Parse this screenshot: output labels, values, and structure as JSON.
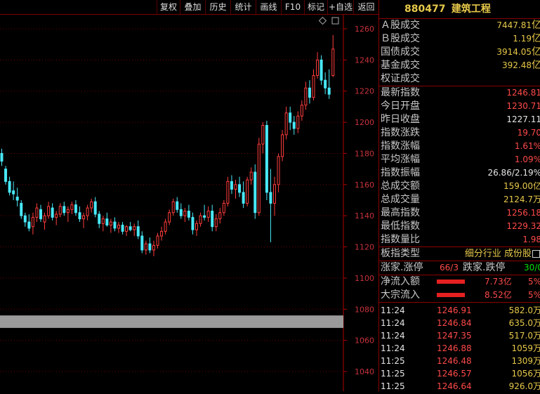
{
  "toolbar": [
    "复权",
    "叠加",
    "历史",
    "统计",
    "画线",
    "F10",
    "标记",
    "+自选",
    "返回"
  ],
  "stock": {
    "code": "880477",
    "name": "建筑工程"
  },
  "volume_rows": [
    {
      "label": "Ａ股成交",
      "value": "7447.81",
      "unit": "亿"
    },
    {
      "label": "Ｂ股成交",
      "value": "1.19",
      "unit": "亿"
    },
    {
      "label": "国债成交",
      "value": "3914.05",
      "unit": "亿"
    },
    {
      "label": "基金成交",
      "value": "392.48",
      "unit": "亿"
    },
    {
      "label": "权证成交",
      "value": "",
      "unit": ""
    }
  ],
  "index_rows": [
    {
      "label": "最新指数",
      "value": "1246.81",
      "color": "r"
    },
    {
      "label": "今日开盘",
      "value": "1230.71",
      "color": "r"
    },
    {
      "label": "昨日收盘",
      "value": "1227.11",
      "color": "w"
    },
    {
      "label": "指数涨跌",
      "value": "19.70",
      "color": "r"
    },
    {
      "label": "指数涨幅",
      "value": "1.61%",
      "color": "r"
    },
    {
      "label": "平均涨幅",
      "value": "1.09%",
      "color": "r"
    },
    {
      "label": "指数振幅",
      "value": "26.86/2.19%",
      "color": "w"
    },
    {
      "label": "总成交额",
      "value": "159.00亿",
      "color": "y"
    },
    {
      "label": "总成交量",
      "value": "2124.7万",
      "color": "y"
    },
    {
      "label": "最高指数",
      "value": "1256.18",
      "color": "r"
    },
    {
      "label": "最低指数",
      "value": "1229.32",
      "color": "r"
    },
    {
      "label": "指数量比",
      "value": "1.98",
      "color": "r"
    }
  ],
  "board": {
    "label": "板指类型",
    "value": "细分行业 成份股"
  },
  "updown": {
    "label1": "涨家.涨停",
    "val1": "66/3",
    "label2": "跌家.跌停",
    "val2": "30/0"
  },
  "flows": [
    {
      "label": "净流入额",
      "value": "7.73亿",
      "pct": "5%"
    },
    {
      "label": "大宗流入",
      "value": "8.52亿",
      "pct": "5%"
    }
  ],
  "ticks": [
    {
      "time": "11:24",
      "price": "1246.91",
      "vol": "582.0万"
    },
    {
      "time": "11:24",
      "price": "1246.84",
      "vol": "635.0万"
    },
    {
      "time": "11:24",
      "price": "1247.35",
      "vol": "517.0万"
    },
    {
      "time": "11:24",
      "price": "1246.88",
      "vol": "1059万"
    },
    {
      "time": "11:25",
      "price": "1246.48",
      "vol": "1309万"
    },
    {
      "time": "11:25",
      "price": "1246.57",
      "vol": "1056万"
    },
    {
      "time": "11:25",
      "price": "1246.64",
      "vol": "926.0万"
    }
  ],
  "chart_data": {
    "type": "candlestick",
    "y_ticks": [
      1260,
      1240,
      1220,
      1200,
      1180,
      1160,
      1140,
      1120,
      1100,
      1080,
      1060,
      1040
    ],
    "ylim": [
      1033,
      1269
    ],
    "candles": [
      [
        1180,
        1183,
        1172,
        1175
      ],
      [
        1170,
        1172,
        1160,
        1162
      ],
      [
        1162,
        1165,
        1153,
        1155
      ],
      [
        1156,
        1162,
        1150,
        1154
      ],
      [
        1152,
        1158,
        1146,
        1150
      ],
      [
        1148,
        1150,
        1138,
        1140
      ],
      [
        1140,
        1142,
        1133,
        1136
      ],
      [
        1136,
        1141,
        1130,
        1132
      ],
      [
        1133,
        1142,
        1128,
        1139
      ],
      [
        1139,
        1148,
        1136,
        1145
      ],
      [
        1144,
        1147,
        1136,
        1138
      ],
      [
        1136,
        1142,
        1131,
        1140
      ],
      [
        1140,
        1149,
        1138,
        1146
      ],
      [
        1145,
        1148,
        1137,
        1139
      ],
      [
        1139,
        1143,
        1134,
        1141
      ],
      [
        1141,
        1148,
        1139,
        1146
      ],
      [
        1146,
        1149,
        1140,
        1142
      ],
      [
        1142,
        1146,
        1136,
        1144
      ],
      [
        1144,
        1149,
        1141,
        1147
      ],
      [
        1147,
        1150,
        1140,
        1142
      ],
      [
        1142,
        1146,
        1136,
        1138
      ],
      [
        1138,
        1142,
        1132,
        1140
      ],
      [
        1140,
        1147,
        1137,
        1145
      ],
      [
        1145,
        1151,
        1142,
        1149
      ],
      [
        1149,
        1152,
        1139,
        1141
      ],
      [
        1141,
        1143,
        1132,
        1135
      ],
      [
        1135,
        1140,
        1130,
        1138
      ],
      [
        1138,
        1142,
        1133,
        1134
      ],
      [
        1134,
        1138,
        1129,
        1136
      ],
      [
        1136,
        1139,
        1130,
        1132
      ],
      [
        1132,
        1136,
        1129,
        1134
      ],
      [
        1134,
        1136,
        1128,
        1130
      ],
      [
        1130,
        1134,
        1127,
        1133
      ],
      [
        1133,
        1136,
        1130,
        1131
      ],
      [
        1131,
        1135,
        1127,
        1133
      ],
      [
        1133,
        1137,
        1125,
        1127
      ],
      [
        1127,
        1130,
        1116,
        1118
      ],
      [
        1118,
        1124,
        1115,
        1122
      ],
      [
        1122,
        1126,
        1116,
        1118
      ],
      [
        1118,
        1124,
        1114,
        1121
      ],
      [
        1121,
        1129,
        1119,
        1127
      ],
      [
        1127,
        1133,
        1124,
        1130
      ],
      [
        1130,
        1138,
        1128,
        1136
      ],
      [
        1136,
        1144,
        1134,
        1142
      ],
      [
        1142,
        1151,
        1140,
        1149
      ],
      [
        1149,
        1152,
        1142,
        1144
      ],
      [
        1144,
        1148,
        1138,
        1140
      ],
      [
        1140,
        1145,
        1136,
        1143
      ],
      [
        1143,
        1147,
        1137,
        1139
      ],
      [
        1139,
        1142,
        1128,
        1131
      ],
      [
        1131,
        1137,
        1127,
        1135
      ],
      [
        1135,
        1142,
        1133,
        1140
      ],
      [
        1140,
        1147,
        1137,
        1139
      ],
      [
        1139,
        1146,
        1136,
        1143
      ],
      [
        1143,
        1147,
        1130,
        1133
      ],
      [
        1133,
        1141,
        1130,
        1138
      ],
      [
        1138,
        1145,
        1135,
        1142
      ],
      [
        1142,
        1150,
        1140,
        1148
      ],
      [
        1148,
        1165,
        1146,
        1162
      ],
      [
        1162,
        1166,
        1154,
        1157
      ],
      [
        1157,
        1163,
        1151,
        1160
      ],
      [
        1160,
        1165,
        1152,
        1155
      ],
      [
        1155,
        1162,
        1145,
        1148
      ],
      [
        1148,
        1165,
        1146,
        1163
      ],
      [
        1163,
        1171,
        1160,
        1168
      ],
      [
        1168,
        1173,
        1138,
        1142
      ],
      [
        1142,
        1190,
        1140,
        1186
      ],
      [
        1186,
        1200,
        1180,
        1198
      ],
      [
        1198,
        1201,
        1150,
        1155
      ],
      [
        1155,
        1170,
        1123,
        1148
      ],
      [
        1148,
        1165,
        1140,
        1160
      ],
      [
        1160,
        1180,
        1155,
        1178
      ],
      [
        1178,
        1195,
        1175,
        1192
      ],
      [
        1192,
        1210,
        1189,
        1206
      ],
      [
        1206,
        1210,
        1195,
        1200
      ],
      [
        1200,
        1204,
        1192,
        1196
      ],
      [
        1196,
        1207,
        1193,
        1204
      ],
      [
        1204,
        1214,
        1201,
        1211
      ],
      [
        1211,
        1226,
        1208,
        1222
      ],
      [
        1222,
        1227,
        1212,
        1216
      ],
      [
        1216,
        1234,
        1214,
        1230
      ],
      [
        1230,
        1245,
        1228,
        1240
      ],
      [
        1240,
        1243,
        1224,
        1227
      ],
      [
        1227,
        1232,
        1218,
        1222
      ],
      [
        1222,
        1234,
        1215,
        1218
      ],
      [
        1230,
        1256,
        1229,
        1247
      ]
    ],
    "selection_band": [
      1068,
      1076
    ]
  }
}
